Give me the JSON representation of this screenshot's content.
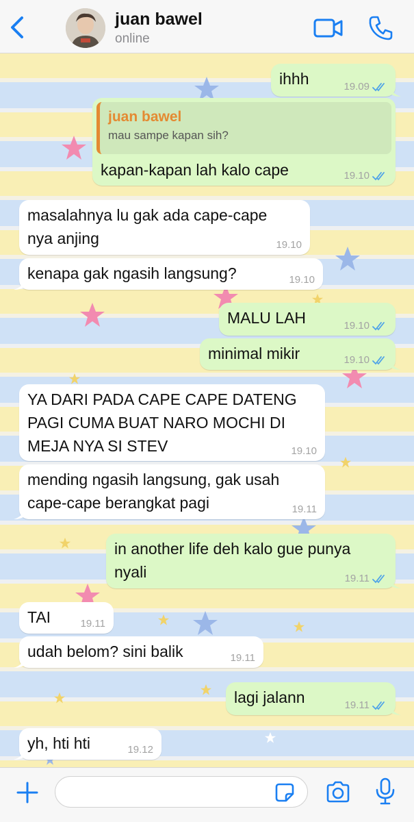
{
  "header": {
    "contact_name": "juan bawel",
    "status": "online",
    "back_icon": "chevron-left-icon",
    "video_icon": "video-camera-icon",
    "call_icon": "phone-icon"
  },
  "colors": {
    "accent": "#1a7ff2",
    "outgoing_bubble": "#dcf8c6",
    "incoming_bubble": "#ffffff",
    "quote_name": "#e48a32",
    "read_ticks": "#4fa3e8"
  },
  "messages": [
    {
      "direction": "out",
      "text": "ihhh",
      "time": "19.09",
      "read": true
    },
    {
      "direction": "out",
      "quote_author": "juan bawel",
      "quote_text": "mau sampe kapan sih?",
      "text": "kapan-kapan lah kalo cape",
      "time": "19.10",
      "read": true
    },
    {
      "direction": "in",
      "text": "masalahnya lu gak ada cape-cape nya anjing",
      "line1": "masalahnya lu gak ada cape-cape",
      "line2": "nya anjing",
      "time": "19.10"
    },
    {
      "direction": "in",
      "text": "kenapa gak ngasih langsung?",
      "time": "19.10"
    },
    {
      "direction": "out",
      "text": "MALU LAH",
      "time": "19.10",
      "read": true
    },
    {
      "direction": "out",
      "text": "minimal mikir",
      "time": "19.10",
      "read": true
    },
    {
      "direction": "in",
      "text": "YA DARI PADA CAPE CAPE DATENG PAGI CUMA BUAT NARO MOCHI DI MEJA NYA SI STEV",
      "line1": "YA DARI PADA CAPE CAPE DATENG",
      "line2": "PAGI CUMA BUAT NARO MOCHI DI",
      "line3": "MEJA NYA SI STEV",
      "time": "19.10"
    },
    {
      "direction": "in",
      "text": "mending ngasih langsung, gak usah cape-cape berangkat pagi",
      "line1": "mending ngasih langsung, gak usah",
      "line2": "cape-cape berangkat pagi",
      "time": "19.11"
    },
    {
      "direction": "out",
      "text": "in another life deh kalo gue punya nyali",
      "line1": "in another life deh kalo gue punya",
      "line2": "nyali",
      "time": "19.11",
      "read": true
    },
    {
      "direction": "in",
      "text": "TAI",
      "time": "19.11"
    },
    {
      "direction": "in",
      "text": "udah belom? sini balik",
      "time": "19.11"
    },
    {
      "direction": "out",
      "text": "lagi jalann",
      "time": "19.11",
      "read": true
    },
    {
      "direction": "in",
      "text": "yh, hti hti",
      "time": "19.12"
    }
  ],
  "composer": {
    "placeholder": "",
    "plus_icon": "plus-icon",
    "sticker_icon": "sticker-icon",
    "camera_icon": "camera-icon",
    "mic_icon": "microphone-icon"
  }
}
